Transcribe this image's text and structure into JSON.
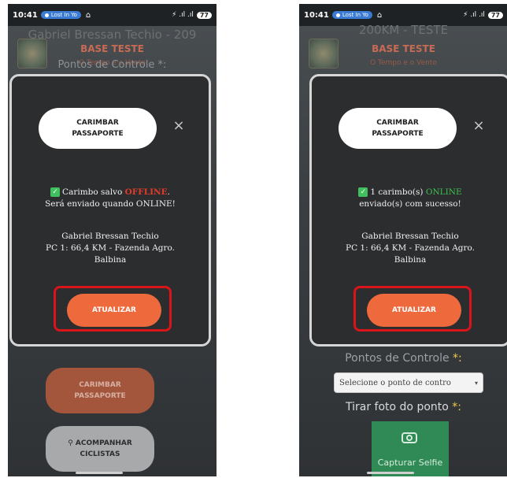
{
  "status_bar": {
    "time": "10:41",
    "pill_label": "Lost In Yo",
    "signal": "⚡ .ıl .ıl",
    "battery": "77"
  },
  "left": {
    "bg_title": "Gabriel Bressan Techio - 209",
    "bg_base": "BASE TESTE",
    "bg_sub": "O Tempo e o Vento",
    "bg_controls": "Pontos de Controle *:",
    "bg_carimbar_line1": "CARIMBAR",
    "bg_carimbar_line2": "PASSAPORTE",
    "bg_acompanhar_line1": "ACOMPANHAR",
    "bg_acompanhar_line2": "CICLISTAS",
    "modal": {
      "button_line1": "CARIMBAR",
      "button_line2": "PASSAPORTE",
      "msg_before": "Carimbo salvo ",
      "msg_status": "OFFLINE",
      "msg_after": ".",
      "msg_line2": "Será enviado quando ONLINE!",
      "name": "Gabriel Bressan Techio",
      "pc_line1": "PC 1: 66,4 KM - Fazenda Agro.",
      "pc_line2": "Balbina",
      "update_label": "ATUALIZAR"
    }
  },
  "right": {
    "bg_title": "200KM - TESTE",
    "bg_base": "BASE TESTE",
    "bg_sub": "O Tempo e o Vento",
    "controls_label": "Pontos de Controle",
    "select_placeholder": "Selecione o ponto de contro",
    "photo_label": "Tirar foto do ponto",
    "selfie_label": "Capturar Selfie",
    "modal": {
      "button_line1": "CARIMBAR",
      "button_line2": "PASSAPORTE",
      "msg_before": "1 carimbo(s) ",
      "msg_status": "ONLINE",
      "msg_line2": "enviado(s) com sucesso!",
      "name": "Gabriel Bressan Techio",
      "pc_line1": "PC 1: 66,4 KM - Fazenda Agro.",
      "pc_line2": "Balbina",
      "update_label": "ATUALIZAR"
    }
  },
  "required_mark": "*:",
  "colors": {
    "accent": "#ee6a3d",
    "offline": "#e23b2a",
    "online": "#3ec24f",
    "highlight": "#d9141b",
    "selfie": "#2f8a55"
  }
}
